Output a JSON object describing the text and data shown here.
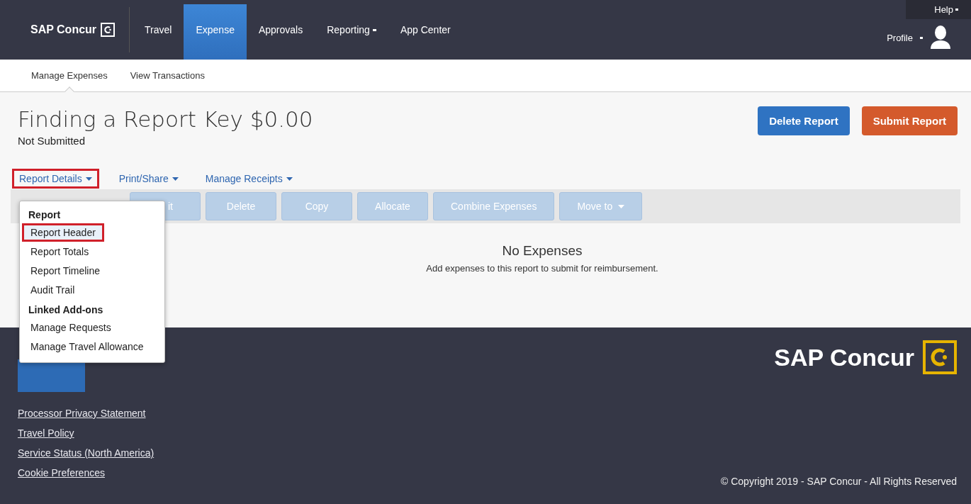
{
  "top_nav": {
    "logo": "SAP Concur",
    "tabs": [
      {
        "label": "Travel",
        "selected": false,
        "dropdown": false
      },
      {
        "label": "Expense",
        "selected": true,
        "dropdown": false
      },
      {
        "label": "Approvals",
        "selected": false,
        "dropdown": false
      },
      {
        "label": "Reporting",
        "selected": false,
        "dropdown": true
      },
      {
        "label": "App Center",
        "selected": false,
        "dropdown": false
      }
    ],
    "help": "Help",
    "profile": "Profile"
  },
  "sub_nav": [
    {
      "label": "Manage Expenses",
      "selected": true
    },
    {
      "label": "View Transactions",
      "selected": false
    }
  ],
  "report": {
    "title": "Finding a Report Key $0.00",
    "status": "Not Submitted"
  },
  "buttons": [
    {
      "label": "Delete Report",
      "kind": "primary"
    },
    {
      "label": "Submit Report",
      "kind": "submit"
    }
  ],
  "report_actions": [
    {
      "label": "Report Details",
      "highlighted": true
    },
    {
      "label": "Print/Share",
      "highlighted": false
    },
    {
      "label": "Manage Receipts",
      "highlighted": false
    }
  ],
  "toolbar": [
    {
      "label": "it",
      "dropdown": false
    },
    {
      "label": "Delete",
      "dropdown": false
    },
    {
      "label": "Copy",
      "dropdown": false
    },
    {
      "label": "Allocate",
      "dropdown": false
    },
    {
      "label": "Combine Expenses",
      "dropdown": false
    },
    {
      "label": "Move to",
      "dropdown": true
    }
  ],
  "empty_state": {
    "title": "No Expenses",
    "message": "Add expenses to this report to submit for reimbursement."
  },
  "menu": [
    {
      "label": "Report",
      "kind": "header"
    },
    {
      "label": "Report Header",
      "kind": "item",
      "highlighted": true
    },
    {
      "label": "Report Totals",
      "kind": "item",
      "highlighted": false
    },
    {
      "label": "Report Timeline",
      "kind": "item",
      "highlighted": false
    },
    {
      "label": "Audit Trail",
      "kind": "item",
      "highlighted": false
    },
    {
      "label": "Linked Add-ons",
      "kind": "header"
    },
    {
      "label": "Manage Requests",
      "kind": "item",
      "highlighted": false
    },
    {
      "label": "Manage Travel Allowance",
      "kind": "item",
      "highlighted": false
    }
  ],
  "footer": {
    "links": [
      "Processor Privacy Statement",
      "Travel Policy",
      "Service Status (North America)",
      "Cookie Preferences"
    ],
    "brand": "SAP Concur",
    "copyright": "© Copyright 2019 - SAP Concur - All Rights Reserved"
  }
}
